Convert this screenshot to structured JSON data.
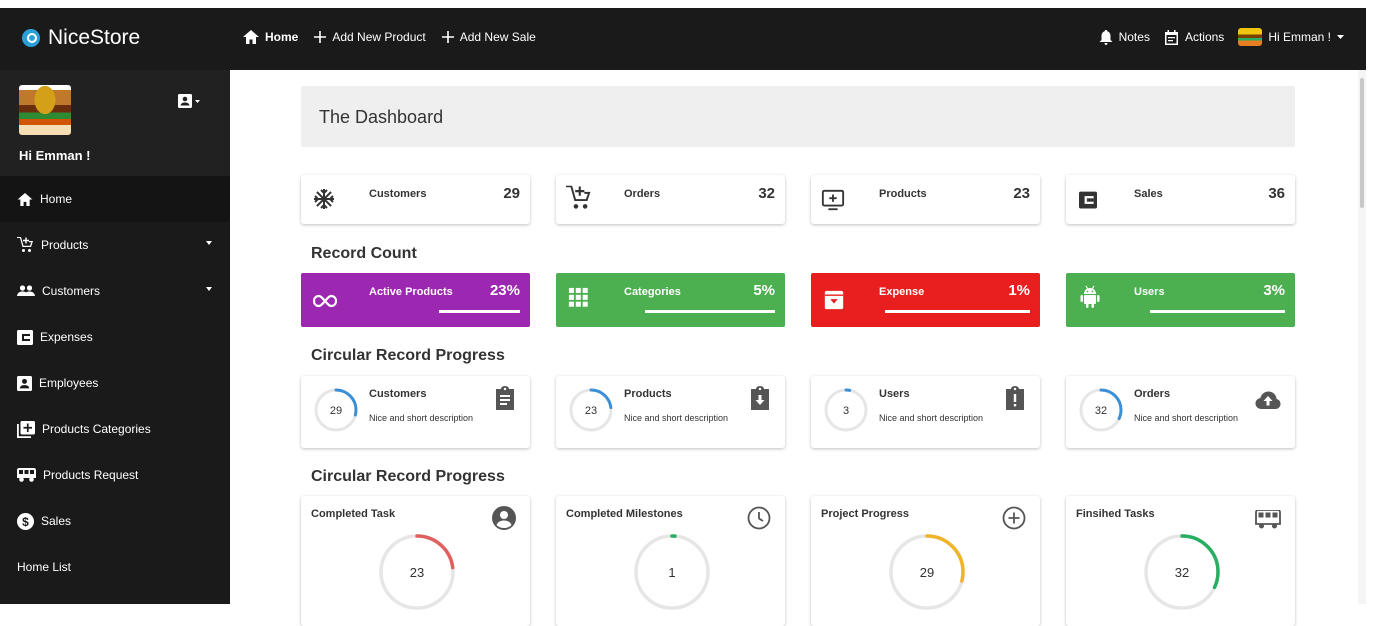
{
  "brand": {
    "name": "NiceStore"
  },
  "topnav": [
    {
      "label": "Home",
      "icon": "home-icon"
    },
    {
      "label": "Add New Product",
      "icon": "plus-icon"
    },
    {
      "label": "Add New Sale",
      "icon": "plus-icon"
    }
  ],
  "topright": {
    "notes": "Notes",
    "actions": "Actions",
    "user": "Hi Emman !"
  },
  "sidebar": {
    "greeting": "Hi Emman !",
    "items": [
      {
        "label": "Home"
      },
      {
        "label": "Products"
      },
      {
        "label": "Customers"
      },
      {
        "label": "Expenses"
      },
      {
        "label": "Employees"
      },
      {
        "label": "Products Categories"
      },
      {
        "label": "Products Request"
      },
      {
        "label": "Sales"
      },
      {
        "label": "Home List"
      }
    ]
  },
  "dashboard": {
    "title": "The Dashboard"
  },
  "stats": [
    {
      "label": "Customers",
      "value": "29",
      "icon": "snowflake-icon"
    },
    {
      "label": "Orders",
      "value": "32",
      "icon": "cart-add-icon"
    },
    {
      "label": "Products",
      "value": "23",
      "icon": "monitor-plus-icon"
    },
    {
      "label": "Sales",
      "value": "36",
      "icon": "wallet-icon"
    }
  ],
  "sections": {
    "record_count": "Record Count",
    "circular_1": "Circular Record Progress",
    "circular_2": "Circular Record Progress"
  },
  "records": [
    {
      "label": "Active Products",
      "value": "23%",
      "color": "#9c27b0",
      "icon": "infinity-icon"
    },
    {
      "label": "Categories",
      "value": "5%",
      "color": "#4caf50",
      "icon": "grid-icon"
    },
    {
      "label": "Expense",
      "value": "1%",
      "color": "#e91e1e",
      "icon": "archive-icon"
    },
    {
      "label": "Users",
      "value": "3%",
      "color": "#4caf50",
      "icon": "android-icon"
    }
  ],
  "circular": [
    {
      "title": "Customers",
      "value": "29",
      "desc": "Nice and short description",
      "progress": 0.29,
      "icon": "clipboard-icon"
    },
    {
      "title": "Products",
      "value": "23",
      "desc": "Nice and short description",
      "progress": 0.23,
      "icon": "clipboard-down-icon"
    },
    {
      "title": "Users",
      "value": "3",
      "desc": "Nice and short description",
      "progress": 0.03,
      "icon": "clipboard-alert-icon"
    },
    {
      "title": "Orders",
      "value": "32",
      "desc": "Nice and short description",
      "progress": 0.32,
      "icon": "cloud-upload-icon"
    }
  ],
  "big_circular": [
    {
      "title": "Completed Task",
      "value": "23",
      "progress": 0.23,
      "color": "#e06060",
      "icon": "account-circle-icon"
    },
    {
      "title": "Completed Milestones",
      "value": "1",
      "progress": 0.01,
      "color": "#27ae60",
      "icon": "clock-icon"
    },
    {
      "title": "Project Progress",
      "value": "29",
      "progress": 0.29,
      "color": "#f0b429",
      "icon": "plus-circle-icon"
    },
    {
      "title": "Finsihed Tasks",
      "value": "32",
      "progress": 0.32,
      "color": "#27ae60",
      "icon": "van-icon"
    }
  ]
}
